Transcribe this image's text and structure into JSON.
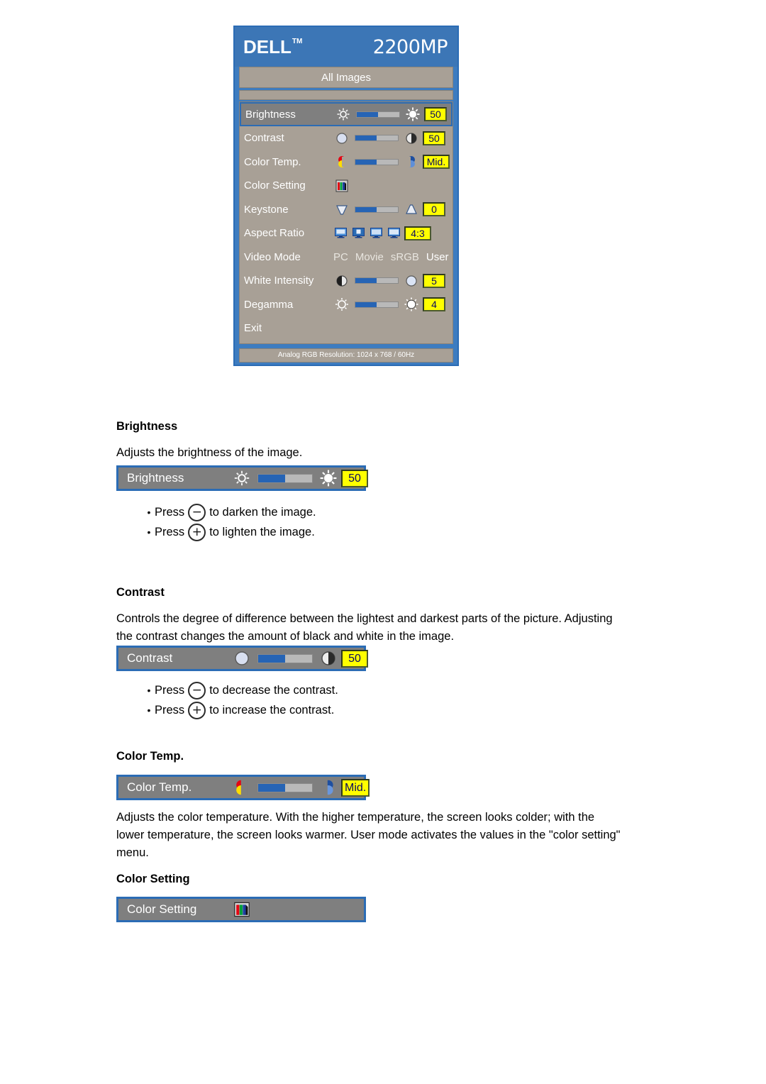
{
  "osd": {
    "brand": "DELL",
    "brand_tm": "TM",
    "model": "2200MP",
    "tab_label": "All Images",
    "status_text": "Analog RGB Resolution: 1024 x 768 / 60Hz",
    "rows": [
      {
        "label": "Brightness",
        "value": "50",
        "selected": true,
        "left_icon": "sun-small-icon",
        "right_icon": "sun-large-icon"
      },
      {
        "label": "Contrast",
        "value": "50",
        "selected": false,
        "left_icon": "circle-light-icon",
        "right_icon": "circle-half-icon"
      },
      {
        "label": "Color Temp.",
        "value": "Mid.",
        "selected": false,
        "left_icon": "warm-color-icon",
        "right_icon": "cold-color-icon"
      },
      {
        "label": "Color Setting",
        "value": "",
        "selected": false,
        "left_icon": "rgb-bars-icon",
        "right_icon": ""
      },
      {
        "label": "Keystone",
        "value": "0",
        "selected": false,
        "left_icon": "keystone-down-icon",
        "right_icon": "keystone-up-icon"
      },
      {
        "label": "Aspect Ratio",
        "value": "4:3",
        "selected": false,
        "left_icon": "screen-icon",
        "right_icon": ""
      },
      {
        "label": "Video Mode",
        "value": "",
        "selected": false,
        "left_icon": "",
        "right_icon": ""
      },
      {
        "label": "White Intensity",
        "value": "5",
        "selected": false,
        "left_icon": "circle-half-icon",
        "right_icon": "circle-light-icon"
      },
      {
        "label": "Degamma",
        "value": "4",
        "selected": false,
        "left_icon": "sun-outline-icon",
        "right_icon": "sun-filled-icon"
      },
      {
        "label": "Exit",
        "value": "",
        "selected": false,
        "left_icon": "",
        "right_icon": ""
      }
    ],
    "video_modes": [
      {
        "label": "PC",
        "active": false
      },
      {
        "label": "Movie",
        "active": false
      },
      {
        "label": "sRGB",
        "active": false
      },
      {
        "label": "User",
        "active": true
      }
    ],
    "aspect_icon_names": [
      "screen-wide-icon",
      "screen-split-icon",
      "screen-normal-icon",
      "screen-plain-icon"
    ]
  },
  "sections": {
    "brightness": {
      "heading": "Brightness",
      "description": "Adjusts the brightness of the image.",
      "bar": {
        "label": "Brightness",
        "value": "50"
      },
      "bullets": [
        {
          "before": "Press",
          "key": "−",
          "after": "to darken the image."
        },
        {
          "before": "Press",
          "key": "+",
          "after": "to lighten the image."
        }
      ]
    },
    "contrast": {
      "heading": "Contrast",
      "description": "Controls the degree of difference between the lightest and darkest parts of the picture. Adjusting the contrast changes the amount of black and white in the image.",
      "bar": {
        "label": "Contrast",
        "value": "50"
      },
      "bullets": [
        {
          "before": "Press",
          "key": "−",
          "after": "to decrease the contrast."
        },
        {
          "before": "Press",
          "key": "+",
          "after": "to increase the contrast."
        }
      ]
    },
    "color_temp": {
      "heading": "Color Temp.",
      "bar": {
        "label": "Color Temp.",
        "value": "Mid."
      },
      "description": "Adjusts the color temperature. With the higher temperature, the screen looks colder; with the lower temperature, the screen looks warmer. User mode activates the values in the \"color setting\" menu."
    },
    "color_setting": {
      "heading": "Color Setting",
      "bar": {
        "label": "Color Setting",
        "value": ""
      }
    }
  },
  "colors": {
    "osd_border_blue": "#2b6cb5",
    "osd_header_blue": "#3c76b6",
    "osd_panel_taupe": "#a8a096",
    "row_selected_grey": "#7f7f7f",
    "value_yellow": "#ffff00",
    "slider_fill_blue": "#2664b5",
    "slider_track_grey": "#b9b9b9"
  }
}
